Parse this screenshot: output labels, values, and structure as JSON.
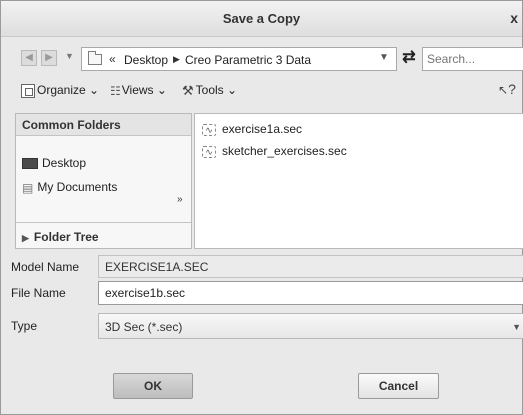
{
  "window": {
    "title": "Save a Copy",
    "close_glyph": "x"
  },
  "address_bar": {
    "crumbs": [
      "Desktop",
      "Creo Parametric 3 Data"
    ],
    "overflow_glyph": "«",
    "separator_glyph": "▶"
  },
  "search": {
    "placeholder": "Search..."
  },
  "toolbar": {
    "organize_label": "Organize",
    "views_label": "Views",
    "tools_label": "Tools",
    "dropdown_glyph": "⌄",
    "help_glyph": "?"
  },
  "left_panel": {
    "header": "Common Folders",
    "items": [
      {
        "label": "Desktop",
        "icon": "desktop-icon"
      },
      {
        "label": "My Documents",
        "icon": "documents-icon"
      }
    ],
    "more_glyph": "»",
    "folder_tree_label": "Folder Tree"
  },
  "files": [
    {
      "name": "exercise1a.sec",
      "icon": "sec-file-icon"
    },
    {
      "name": "sketcher_exercises.sec",
      "icon": "sec-file-icon"
    }
  ],
  "form": {
    "model_name_label": "Model Name",
    "model_name_value": "EXERCISE1A.SEC",
    "file_name_label": "File Name",
    "file_name_value": "exercise1b.sec",
    "type_label": "Type",
    "type_value": "3D Sec (*.sec)"
  },
  "buttons": {
    "ok": "OK",
    "cancel": "Cancel"
  }
}
